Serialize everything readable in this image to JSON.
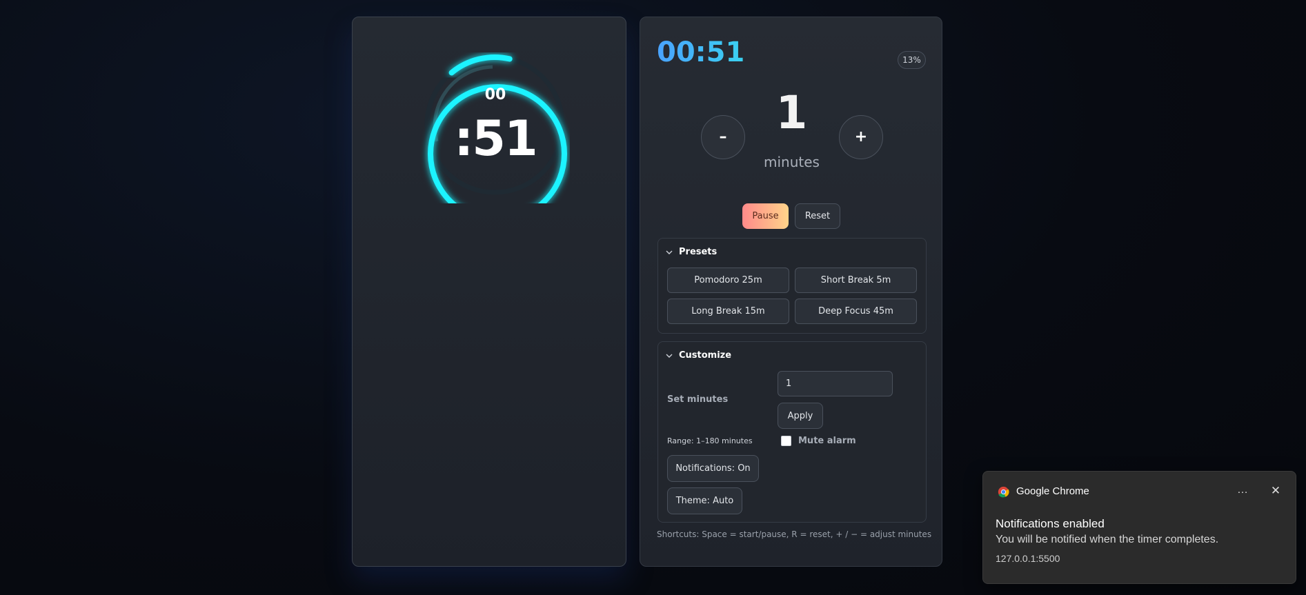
{
  "focus_ring": {
    "hours_label": "00",
    "seconds_label": ":51",
    "progress_fraction": 0.13,
    "ring_color": "#1ef3ff"
  },
  "timer": {
    "digital": "00:51",
    "percent_badge": "13%",
    "minutes_value": "1",
    "minutes_unit": "minutes",
    "minus_label": "–",
    "plus_label": "+",
    "pause_label": "Pause",
    "reset_label": "Reset"
  },
  "presets": {
    "title": "Presets",
    "items": [
      "Pomodoro 25m",
      "Short Break 5m",
      "Long Break 15m",
      "Deep Focus 45m"
    ]
  },
  "customize": {
    "title": "Customize",
    "set_minutes_label": "Set minutes",
    "minutes_input_value": "1",
    "apply_label": "Apply",
    "range_text": "Range: 1–180 minutes",
    "mute_label": "Mute alarm",
    "mute_checked": false,
    "notifications_label": "Notifications: On",
    "theme_label": "Theme: Auto"
  },
  "shortcuts_text": "Shortcuts: Space = start/pause, R = reset, + / − = adjust minutes",
  "toast": {
    "app_name": "Google Chrome",
    "more_icon": "…",
    "close_icon": "✕",
    "title": "Notifications enabled",
    "body": "You will be notified when the timer completes.",
    "source": "127.0.0.1:5500"
  },
  "colors": {
    "accent_cyan": "#1ef3ff",
    "digital_gradient_start": "#4aa3ff",
    "digital_gradient_end": "#3ad1f0",
    "pause_gradient_start": "#ff8a8a",
    "pause_gradient_end": "#ffd48a"
  }
}
